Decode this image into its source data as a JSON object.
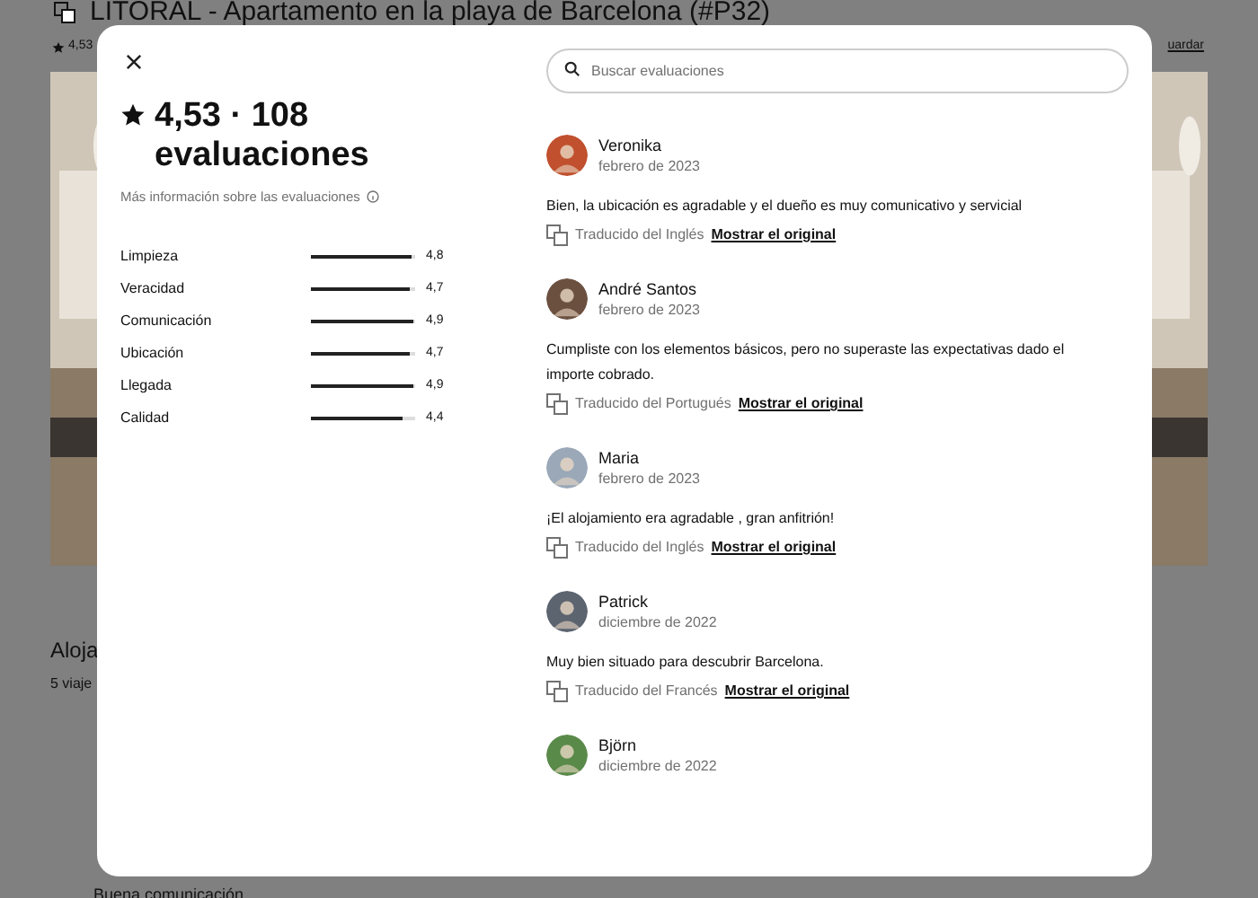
{
  "page": {
    "title": "LITORAL - Apartamento en la playa de Barcelona (#P32)",
    "rating": "4,53",
    "save_link": "uardar",
    "section_title": "Aloja",
    "section_subtitle": "5 viaje",
    "feature": "Buena comunicación"
  },
  "modal": {
    "summary": "4,53 · 108 evaluaciones",
    "info_link": "Más información sobre las evaluaciones",
    "categories": [
      {
        "name": "Limpieza",
        "level": 0.96,
        "score": "4,8"
      },
      {
        "name": "Veracidad",
        "level": 0.94,
        "score": "4,7"
      },
      {
        "name": "Comunicación",
        "level": 0.98,
        "score": "4,9"
      },
      {
        "name": "Ubicación",
        "level": 0.94,
        "score": "4,7"
      },
      {
        "name": "Llegada",
        "level": 0.98,
        "score": "4,9"
      },
      {
        "name": "Calidad",
        "level": 0.88,
        "score": "4,4"
      }
    ],
    "search": {
      "placeholder": "Buscar evaluaciones"
    },
    "reviews": [
      {
        "name": "Veronika",
        "date": "febrero de 2023",
        "text": "Bien, la ubicación es agradable y el dueño es muy comunicativo y servicial",
        "translation": "Traducido del Inglés",
        "link": "Mostrar el original",
        "color": "#c0502e"
      },
      {
        "name": "André Santos",
        "date": "febrero de 2023",
        "text": "Cumpliste con los elementos básicos, pero no superaste las expectativas dado el importe cobrado.",
        "translation": "Traducido del Portugués",
        "link": "Mostrar el original",
        "color": "#6b5040"
      },
      {
        "name": "Maria",
        "date": "febrero de 2023",
        "text": "¡El alojamiento era agradable , gran anfitrión!",
        "translation": "Traducido del Inglés",
        "link": "Mostrar el original",
        "color": "#9aa8b8"
      },
      {
        "name": "Patrick",
        "date": "diciembre de 2022",
        "text": "Muy bien situado para descubrir Barcelona.",
        "translation": "Traducido del Francés",
        "link": "Mostrar el original",
        "color": "#5c6470"
      },
      {
        "name": "Björn",
        "date": "diciembre de 2022"
      }
    ]
  }
}
